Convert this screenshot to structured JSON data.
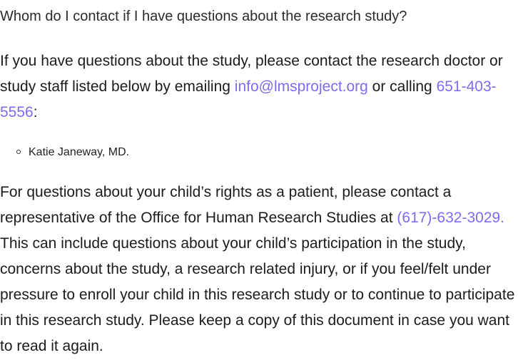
{
  "question": "Whom do I contact if I have questions about the research study?",
  "paragraph1": {
    "before_email": "If you have questions about the study, please contact the research doctor or study staff listed below by emailing ",
    "email": "info@lmsproject.org",
    "between": " or calling ",
    "phone": "651-403-5556",
    "after": ":"
  },
  "contacts": [
    {
      "name": "Katie Janeway, MD."
    }
  ],
  "paragraph2": {
    "before_phone": "For questions about your child’s rights as a patient, please contact a representative of the Office for Human Research Studies at ",
    "phone": "(617)-632-3029.",
    "after": " This can include questions about your child’s participation in the study, concerns about the study, a research related injury, or if you feel/felt under pressure to enroll your child in this research study or to continue to participate in this research study. Please keep a copy of this document in case you want to read it again."
  },
  "colors": {
    "link": "#7b6cf0",
    "text": "#1c1c1c"
  }
}
